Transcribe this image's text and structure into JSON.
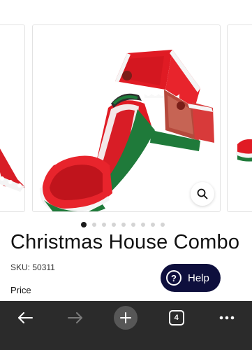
{
  "carousel": {
    "slide_count": 9,
    "active_slide": 1
  },
  "product": {
    "title": "Christmas House Combo",
    "sku": "SKU: 50311",
    "price_label": "Price"
  },
  "help_button": {
    "label": "Help",
    "icon": "?"
  },
  "browser_toolbar": {
    "back_icon": "arrow-left-icon",
    "forward_icon": "arrow-right-icon",
    "new_tab_icon": "plus-icon",
    "tab_count": "4",
    "menu_icon": "more-dots-icon"
  },
  "colors": {
    "help_bg": "#0e0f3d",
    "toolbar_bg": "#2b2b2b",
    "inflatable_red": "#e01b24",
    "inflatable_green": "#1f7a3a"
  }
}
